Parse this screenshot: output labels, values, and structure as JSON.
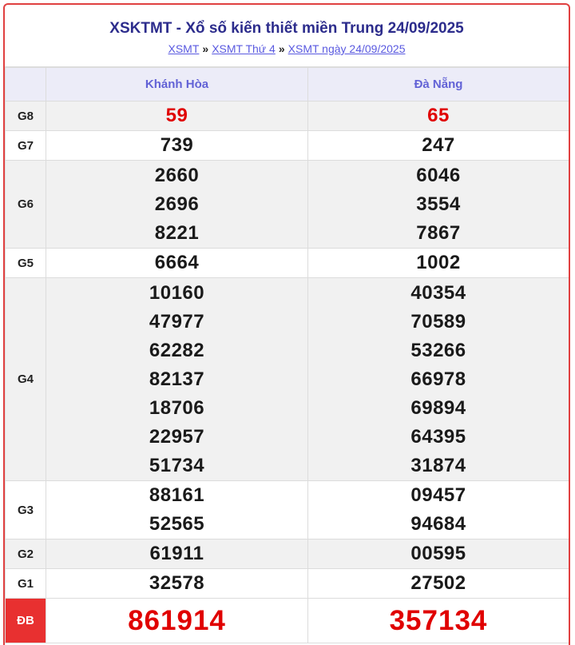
{
  "header": {
    "title": "XSKTMT - Xổ số kiến thiết miền Trung 24/09/2025",
    "breadcrumb": [
      "XSMT",
      "XSMT Thứ 4",
      "XSMT ngày 24/09/2025"
    ],
    "separator": "»"
  },
  "provinces": [
    "Khánh Hòa",
    "Đà Nẵng"
  ],
  "prizes": {
    "g8": {
      "label": "G8",
      "p1": [
        "59"
      ],
      "p2": [
        "65"
      ]
    },
    "g7": {
      "label": "G7",
      "p1": [
        "739"
      ],
      "p2": [
        "247"
      ]
    },
    "g6": {
      "label": "G6",
      "p1": [
        "2660",
        "2696",
        "8221"
      ],
      "p2": [
        "6046",
        "3554",
        "7867"
      ]
    },
    "g5": {
      "label": "G5",
      "p1": [
        "6664"
      ],
      "p2": [
        "1002"
      ]
    },
    "g4": {
      "label": "G4",
      "p1": [
        "10160",
        "47977",
        "62282",
        "82137",
        "18706",
        "22957",
        "51734"
      ],
      "p2": [
        "40354",
        "70589",
        "53266",
        "66978",
        "69894",
        "64395",
        "31874"
      ]
    },
    "g3": {
      "label": "G3",
      "p1": [
        "88161",
        "52565"
      ],
      "p2": [
        "09457",
        "94684"
      ]
    },
    "g2": {
      "label": "G2",
      "p1": [
        "61911"
      ],
      "p2": [
        "00595"
      ]
    },
    "g1": {
      "label": "G1",
      "p1": [
        "32578"
      ],
      "p2": [
        "27502"
      ]
    },
    "db": {
      "label": "ĐB",
      "p1": [
        "861914"
      ],
      "p2": [
        "357134"
      ]
    }
  },
  "colors": {
    "accent_red": "#e00000",
    "title_blue": "#2c2c8c",
    "link_blue": "#5a5ae0",
    "header_bg": "#ececf8"
  }
}
